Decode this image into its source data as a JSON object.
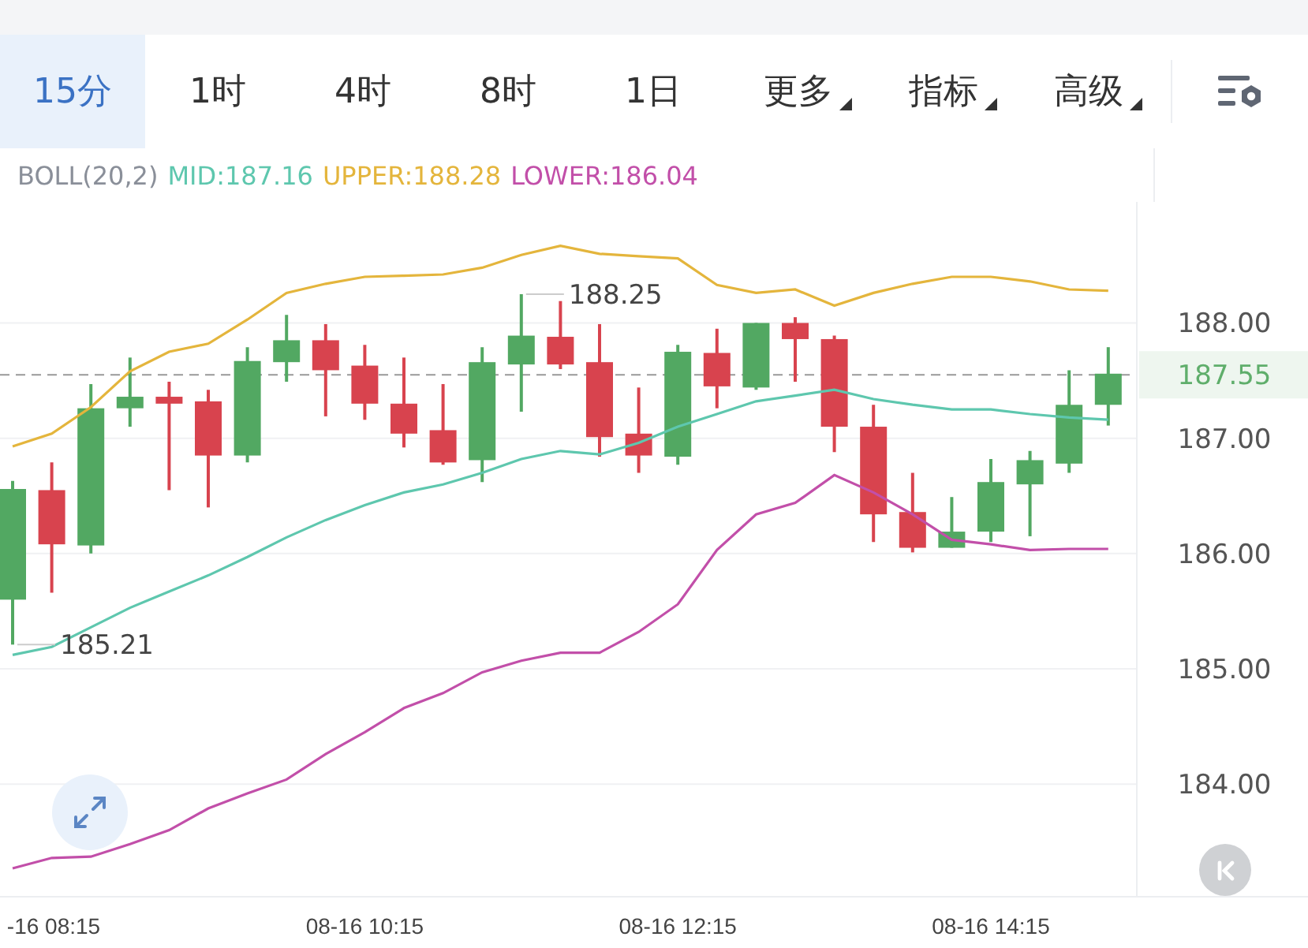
{
  "toolbar": {
    "tabs": [
      {
        "label": "15分",
        "selected": true,
        "menu": false
      },
      {
        "label": "1时",
        "selected": false,
        "menu": false
      },
      {
        "label": "4时",
        "selected": false,
        "menu": false
      },
      {
        "label": "8时",
        "selected": false,
        "menu": false
      },
      {
        "label": "1日",
        "selected": false,
        "menu": false
      },
      {
        "label": "更多",
        "selected": false,
        "menu": true
      },
      {
        "label": "指标",
        "selected": false,
        "menu": true
      },
      {
        "label": "高级",
        "selected": false,
        "menu": true
      }
    ]
  },
  "legend": {
    "title": "BOLL(20,2)",
    "values": [
      ":187.16",
      ":188.28",
      ":186.04"
    ]
  },
  "chart": {
    "chart_data": {
      "type": "line",
      "grid": true,
      "ylim": [
        183.03,
        189.05
      ],
      "categories": [
        null,
        "-16 08:15",
        null,
        null,
        null,
        null,
        null,
        null,
        null,
        "08-16 10:15",
        null,
        null,
        null,
        null,
        null,
        null,
        null,
        "08-16 12:15",
        null,
        null,
        null,
        null,
        null,
        null,
        null,
        "08-16 14:15",
        null,
        null,
        null
      ],
      "yticks": [
        {
          "value": 184,
          "label": "184.00"
        },
        {
          "value": 185,
          "label": "185.00"
        },
        {
          "value": 186,
          "label": "186.00"
        },
        {
          "value": 187,
          "label": "187.00"
        },
        {
          "value": 188,
          "label": "188.00"
        }
      ],
      "series": [
        {
          "name": "MID",
          "color": "#5ec7ae",
          "values": [
            185.12,
            185.19,
            185.36,
            185.53,
            185.67,
            185.81,
            185.97,
            186.14,
            186.29,
            186.42,
            186.53,
            186.6,
            186.7,
            186.82,
            186.89,
            186.86,
            186.96,
            187.1,
            187.21,
            187.32,
            187.37,
            187.42,
            187.34,
            187.29,
            187.25,
            187.25,
            187.21,
            187.18,
            187.16
          ]
        },
        {
          "name": "UPPER",
          "color": "#e4b53c",
          "values": [
            186.93,
            187.04,
            187.27,
            187.58,
            187.75,
            187.82,
            188.03,
            188.26,
            188.34,
            188.4,
            188.41,
            188.42,
            188.48,
            188.59,
            188.67,
            188.6,
            188.58,
            188.56,
            188.33,
            188.26,
            188.29,
            188.15,
            188.26,
            188.34,
            188.4,
            188.4,
            188.36,
            188.29,
            188.28
          ]
        },
        {
          "name": "LOWER",
          "color": "#c24fa9",
          "values": [
            183.27,
            183.36,
            183.37,
            183.48,
            183.6,
            183.79,
            183.92,
            184.04,
            184.26,
            184.45,
            184.66,
            184.79,
            184.97,
            185.07,
            185.14,
            185.14,
            185.32,
            185.56,
            186.03,
            186.34,
            186.44,
            186.68,
            186.53,
            186.34,
            186.12,
            186.08,
            186.03,
            186.04,
            186.04
          ]
        }
      ],
      "annotations": [
        "188.25",
        "185.21"
      ],
      "ref_lines": [
        {
          "axis": "y",
          "value": 187.55,
          "label": "187.55"
        }
      ]
    }
  }
}
